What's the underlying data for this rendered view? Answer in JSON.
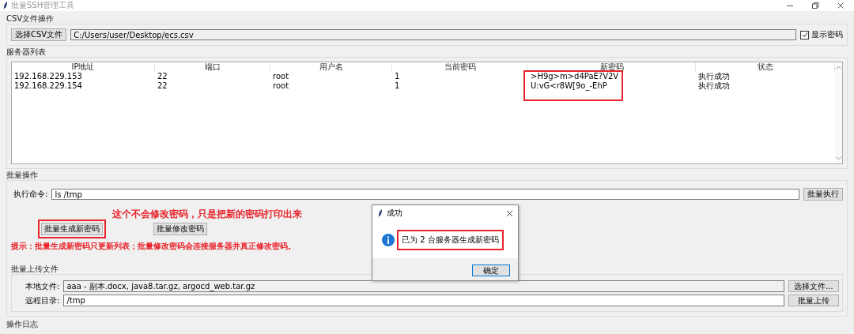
{
  "window": {
    "title": "批量SSH管理工具"
  },
  "csv_group": {
    "title": "CSV文件操作",
    "choose_button": "选择CSV文件",
    "path": "C:/Users/user/Desktop/ecs.csv",
    "show_password": {
      "label": "显示密码",
      "checked": true
    }
  },
  "server_list": {
    "title": "服务器列表",
    "columns": [
      "IP地址",
      "端口",
      "用户名",
      "当前密码",
      "新密码",
      "状态"
    ],
    "rows": [
      [
        "192.168.229.153",
        "22",
        "root",
        "1",
        ">H9g>m>d4PaE?V2V",
        "执行成功"
      ],
      [
        "192.168.229.154",
        "22",
        "root",
        "1",
        "U:vG<r8W[9o_-EhP",
        "执行成功"
      ]
    ]
  },
  "batch_ops": {
    "title": "批量操作",
    "command_label": "执行命令:",
    "command": "ls /tmp",
    "execute_button": "批量执行",
    "note": "这个不会修改密码，只是把新的密码打印出来",
    "generate_button": "批量生成新密码",
    "modify_button": "批量修改密码",
    "hint": "提示：批量生成新密码只更新列表；批量修改密码会连接服务器并真正修改密码。",
    "upload": {
      "title": "批量上传文件",
      "local_label": "本地文件:",
      "local_files": "aaa - 副本.docx, java8.tar.gz, argocd_web.tar.gz",
      "browse_button": "选择文件...",
      "remote_label": "远程目录:",
      "remote_dir": "/tmp",
      "upload_button": "批量上传"
    }
  },
  "log_title": "操作日志",
  "dialog": {
    "title": "成功",
    "message": "已为 2 台服务器生成新密码",
    "ok_button": "确定"
  }
}
